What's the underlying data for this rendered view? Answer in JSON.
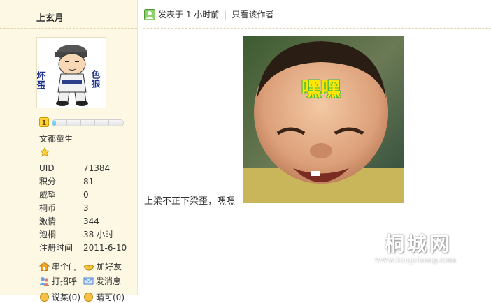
{
  "author": {
    "name": "上玄月",
    "rank_title": "文都童生",
    "avatar_text_left": "坏蛋",
    "avatar_text_right": "色狼"
  },
  "level": {
    "progress_fraction": 0.05
  },
  "stats": [
    {
      "label": "UID",
      "value": "71384"
    },
    {
      "label": "积分",
      "value": "81"
    },
    {
      "label": "威望",
      "value": "0"
    },
    {
      "label": "桐币",
      "value": "3"
    },
    {
      "label": "激情",
      "value": "344"
    },
    {
      "label": "泡桐",
      "value": "38 小时"
    },
    {
      "label": "注册时间",
      "value": "2011-6-10"
    }
  ],
  "actions": {
    "visit": "串个门",
    "greet": "加好友",
    "poke": "打招呼",
    "message": "发消息",
    "more1": "说某(0)",
    "more2": "晴可(0)"
  },
  "post": {
    "posted_label": "发表于 1 小时前",
    "only_author_label": "只看该作者",
    "text": "上梁不正下梁歪，嘿嘿",
    "photo_caption": "嘿嘿"
  },
  "watermark": {
    "title": "桐城网",
    "url": "www.tongcheng.com"
  },
  "colors": {
    "sidebar_bg": "#fcf8e3",
    "progress": "#4fbde8",
    "caption": "#ffe600"
  }
}
